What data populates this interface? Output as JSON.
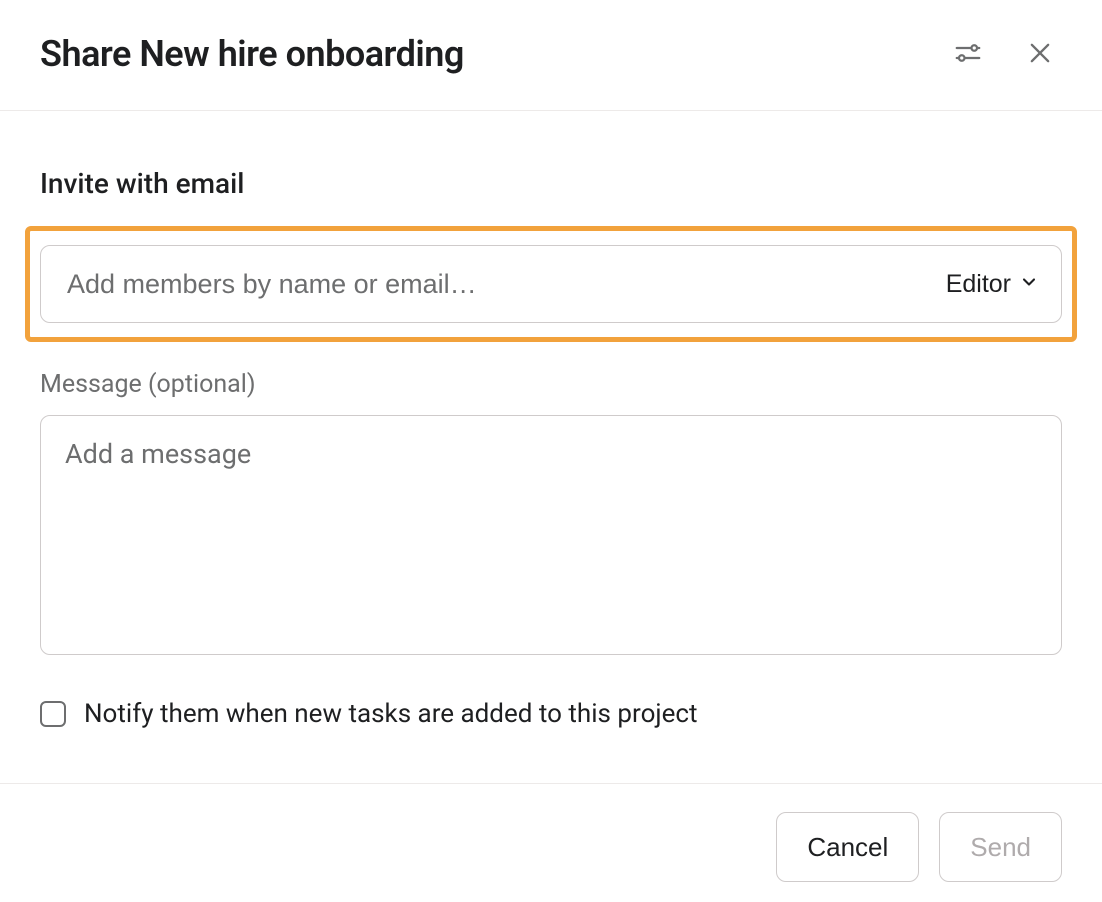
{
  "header": {
    "title": "Share New hire onboarding"
  },
  "invite": {
    "section_label": "Invite with email",
    "input_placeholder": "Add members by name or email…",
    "role_selected": "Editor"
  },
  "message": {
    "label": "Message (optional)",
    "placeholder": "Add a message"
  },
  "notify": {
    "label": "Notify them when new tasks are added to this project",
    "checked": false
  },
  "footer": {
    "cancel": "Cancel",
    "send": "Send"
  }
}
